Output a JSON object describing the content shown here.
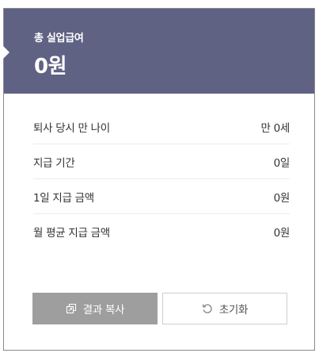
{
  "header": {
    "title": "총 실업급여",
    "amount": "0원"
  },
  "rows": [
    {
      "label": "퇴사 당시 만 나이",
      "value": "만 0세"
    },
    {
      "label": "지급 기간",
      "value": "0일"
    },
    {
      "label": "1일 지급 금액",
      "value": "0원"
    },
    {
      "label": "월 평균 지급 금액",
      "value": "0원"
    }
  ],
  "buttons": {
    "copy_label": "결과 복사",
    "copy_icon": "copy-icon",
    "reset_label": "초기화",
    "reset_icon": "refresh-icon"
  },
  "colors": {
    "header_bg": "#5f6283",
    "copy_button_bg": "#9e9e9e"
  }
}
